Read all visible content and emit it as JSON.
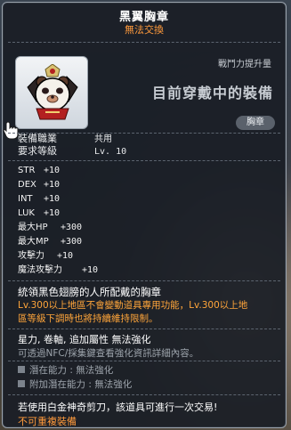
{
  "item": {
    "name": "黑翼胸章",
    "trade_status": "無法交換",
    "power_label": "戰鬥力提升量",
    "equipped_text": "目前穿戴中的裝備",
    "category_badge": "胸章",
    "icon": "bear-badge-icon"
  },
  "requirements": [
    {
      "label": "裝備職業",
      "value": "共用"
    },
    {
      "label": "要求等級",
      "value": "Lv. 10"
    }
  ],
  "stats": [
    {
      "label": "STR",
      "value": "+10"
    },
    {
      "label": "DEX",
      "value": "+10"
    },
    {
      "label": "INT",
      "value": "+10"
    },
    {
      "label": "LUK",
      "value": "+10"
    },
    {
      "label": "最大HP",
      "value": "+300"
    },
    {
      "label": "最大MP",
      "value": "+300"
    },
    {
      "label": "攻擊力",
      "value": "+10"
    },
    {
      "label": "魔法攻擊力",
      "value": "+10"
    }
  ],
  "description": "統領黑色翅膀的人所配戴的胸章",
  "restriction": {
    "line1": "Lv.300以上地區不會變動道具專用功能，Lv.300以上地",
    "line2": "區等級下調時也將持續維持限制。"
  },
  "enhance_status": "星力, 卷軸, 追加屬性  無法強化",
  "nfc_note": "可透過NFC/採集鍵查看強化資訊詳細內容。",
  "potential": {
    "label": "潛在能力 : 無法強化"
  },
  "additional_potential": {
    "label": "附加潛在能力 : 無法強化"
  },
  "scissors_note": "若使用白金神奇剪刀，該道具可進行一次交易!",
  "no_duplicate": "不可重複裝備",
  "colors": {
    "accent_orange": "#ff9a3c",
    "panel_bg": "#1a1e26",
    "border": "#9aa3ad"
  }
}
